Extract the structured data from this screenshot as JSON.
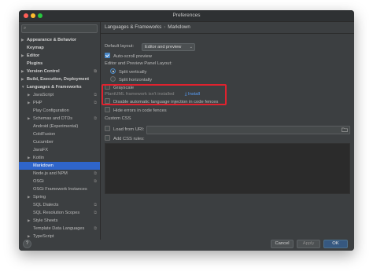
{
  "window": {
    "title": "Preferences"
  },
  "sidebar": {
    "search_placeholder": "",
    "items": [
      {
        "label": "Appearance & Behavior",
        "bold": true,
        "arrow": "▶",
        "indent": 0
      },
      {
        "label": "Keymap",
        "bold": true,
        "arrow": "",
        "indent": 0
      },
      {
        "label": "Editor",
        "bold": true,
        "arrow": "▶",
        "indent": 0
      },
      {
        "label": "Plugins",
        "bold": true,
        "arrow": "",
        "indent": 0
      },
      {
        "label": "Version Control",
        "bold": true,
        "arrow": "▶",
        "indent": 0,
        "proj": "⧉"
      },
      {
        "label": "Build, Execution, Deployment",
        "bold": true,
        "arrow": "▶",
        "indent": 0
      },
      {
        "label": "Languages & Frameworks",
        "bold": true,
        "arrow": "▼",
        "indent": 0
      },
      {
        "label": "JavaScript",
        "bold": false,
        "arrow": "▶",
        "indent": 1,
        "proj": "⧉"
      },
      {
        "label": "PHP",
        "bold": false,
        "arrow": "▶",
        "indent": 1,
        "proj": "⧉"
      },
      {
        "label": "Play Configuration",
        "bold": false,
        "arrow": "",
        "indent": 1
      },
      {
        "label": "Schemas and DTDs",
        "bold": false,
        "arrow": "▶",
        "indent": 1,
        "proj": "⧉"
      },
      {
        "label": "Android (Experimental)",
        "bold": false,
        "arrow": "",
        "indent": 1
      },
      {
        "label": "ColdFusion",
        "bold": false,
        "arrow": "",
        "indent": 1
      },
      {
        "label": "Cucumber",
        "bold": false,
        "arrow": "",
        "indent": 1
      },
      {
        "label": "JavaFX",
        "bold": false,
        "arrow": "",
        "indent": 1
      },
      {
        "label": "Kotlin",
        "bold": false,
        "arrow": "▶",
        "indent": 1
      },
      {
        "label": "Markdown",
        "bold": false,
        "arrow": "",
        "indent": 1,
        "selected": true
      },
      {
        "label": "Node.js and NPM",
        "bold": false,
        "arrow": "",
        "indent": 1,
        "proj": "⧉"
      },
      {
        "label": "OSGi",
        "bold": false,
        "arrow": "",
        "indent": 1,
        "proj": "⧉"
      },
      {
        "label": "OSGi Framework Instances",
        "bold": false,
        "arrow": "",
        "indent": 1
      },
      {
        "label": "Spring",
        "bold": false,
        "arrow": "▶",
        "indent": 1
      },
      {
        "label": "SQL Dialects",
        "bold": false,
        "arrow": "",
        "indent": 1,
        "proj": "⧉"
      },
      {
        "label": "SQL Resolution Scopes",
        "bold": false,
        "arrow": "",
        "indent": 1,
        "proj": "⧉"
      },
      {
        "label": "Style Sheets",
        "bold": false,
        "arrow": "▶",
        "indent": 1
      },
      {
        "label": "Template Data Languages",
        "bold": false,
        "arrow": "",
        "indent": 1,
        "proj": "⧉"
      },
      {
        "label": "TypeScript",
        "bold": false,
        "arrow": "▶",
        "indent": 1
      }
    ]
  },
  "content": {
    "breadcrumb": [
      "Languages & Frameworks",
      "Markdown"
    ],
    "default_layout_label": "Default layout:",
    "default_layout_value": "Editor and preview",
    "auto_scroll_label": "Auto-scroll preview",
    "panel_layout_label": "Editor and Preview Panel Layout:",
    "split_vertically": "Split vertically",
    "split_horizontally": "Split horizontally",
    "grayscale_label": "Grayscale",
    "plantuml_label": "PlantUML framework isn't installed",
    "install_link": "Install",
    "disable_injection_label": "Disable automatic language injection in code fences",
    "hide_errors_label": "Hide errors in code fences",
    "custom_css_label": "Custom CSS",
    "load_from_uri_label": "Load from URI:",
    "add_css_rules_label": "Add CSS rules:"
  },
  "buttons": {
    "help": "?",
    "cancel": "Cancel",
    "apply": "Apply",
    "ok": "OK"
  },
  "colors": {
    "selection": "#2f65ca",
    "link": "#589df6",
    "highlight_box": "#e0222e",
    "ok_button": "#365880"
  }
}
